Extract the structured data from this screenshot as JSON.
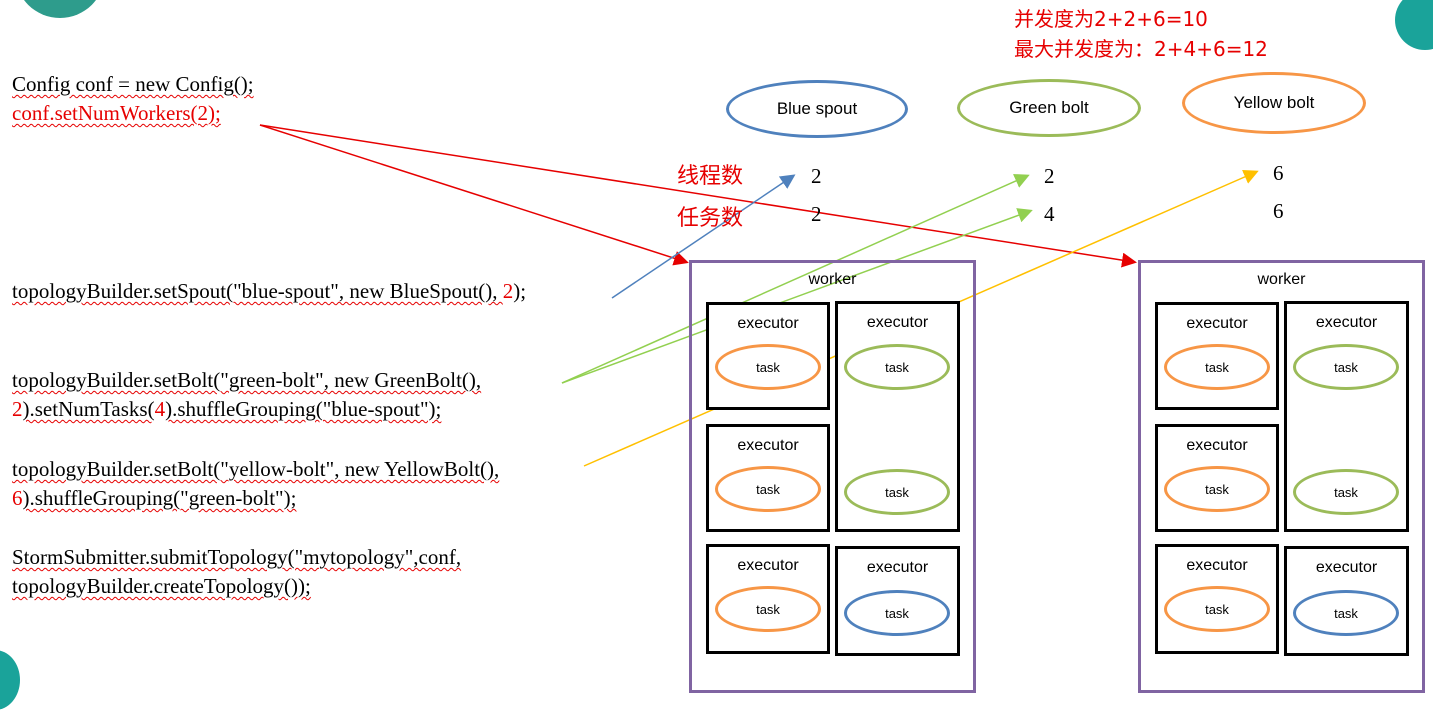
{
  "notes": {
    "concurrency": "并发度为2+2+6=10",
    "max_concurrency": "最大并发度为：2+4+6=12"
  },
  "code": {
    "line1": "Config conf = new Config();",
    "line2": "conf.setNumWorkers(2);",
    "spout_pre": "topologyBuilder.setSpout(\"blue-spout\", new BlueSpout(), ",
    "spout_num": "2",
    "spout_post": ");",
    "green_line1": "topologyBuilder.setBolt(\"green-bolt\", new GreenBolt(),",
    "green_num1": "2",
    "green_mid": ").setNumTasks(",
    "green_num2": "4",
    "green_post": ").shuffleGrouping(\"blue-spout\");",
    "yellow_line1": "topologyBuilder.setBolt(\"yellow-bolt\", new YellowBolt(),",
    "yellow_num": "6",
    "yellow_post": ").shuffleGrouping(\"green-bolt\");",
    "submit_line1": "StormSubmitter.submitTopology(\"mytopology\",conf,",
    "submit_line2": "topologyBuilder.createTopology());"
  },
  "components": {
    "blue_spout": "Blue spout",
    "green_bolt": "Green bolt",
    "yellow_bolt": "Yellow bolt"
  },
  "labels": {
    "threads": "线程数",
    "tasks": "任务数"
  },
  "counts": {
    "blue_threads": "2",
    "blue_tasks": "2",
    "green_threads": "2",
    "green_tasks": "4",
    "yellow_threads": "6",
    "yellow_tasks": "6"
  },
  "worker_label": "worker",
  "executor_label": "executor",
  "task_label": "task",
  "colors": {
    "red": "#e60000",
    "blue": "#4f81bd",
    "green": "#9bbb59",
    "orange": "#f79646",
    "yellow_arrow": "#ffc000",
    "worker_border": "#8064a2"
  }
}
